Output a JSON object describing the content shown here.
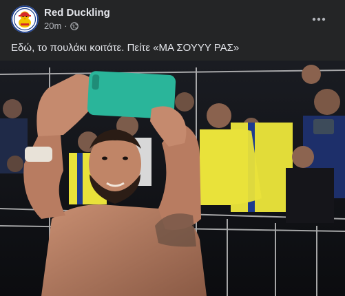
{
  "post": {
    "page_name": "Red Duckling",
    "timestamp": "20m",
    "separator": "·",
    "privacy_icon": "globe-icon",
    "more_icon": "more-horizontal-icon",
    "caption": "Εδώ, το πουλάκι κοιτάτε. Πείτε «ΜΑ ΣΟΥΥΥ ΡΑΣ»",
    "photo": {
      "description_icon": "photo",
      "phone_color": "#2ab59a",
      "jersey_color": "#e9e23a",
      "stripe_color": "#1d3b8f"
    }
  },
  "colors": {
    "background": "#242526",
    "text_primary": "#e4e6eb",
    "text_secondary": "#b0b3b8",
    "avatar_accent": "#d62828"
  }
}
